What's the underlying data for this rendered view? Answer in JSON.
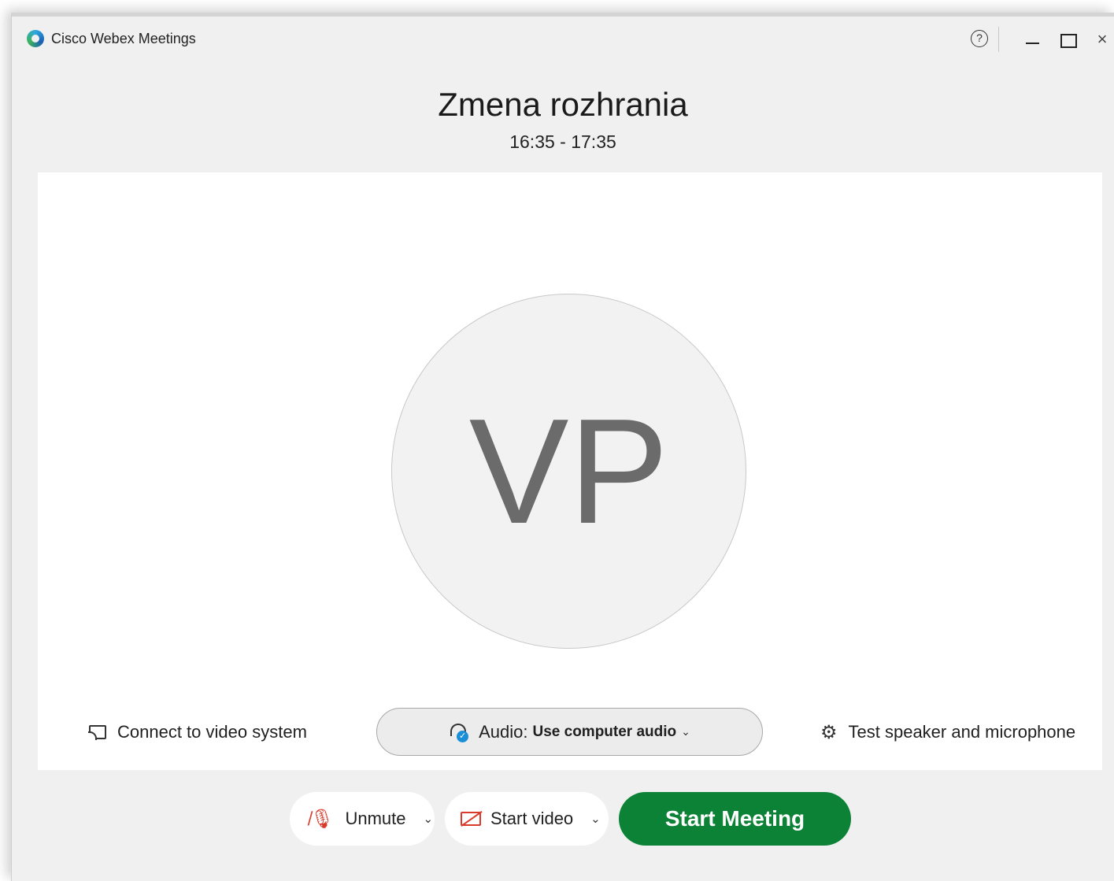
{
  "window": {
    "app_title": "Cisco Webex Meetings",
    "help_icon": "help-icon",
    "controls": {
      "minimize": "minimize-icon",
      "maximize": "maximize-icon",
      "close": "×"
    }
  },
  "meeting": {
    "title": "Zmena rozhrania",
    "time": "16:35 - 17:35"
  },
  "preview": {
    "avatar_initials": "VP",
    "connect_label": "Connect to video system",
    "audio_label": "Audio:",
    "audio_value": "Use computer audio",
    "audio_chevron": "⌄",
    "test_label": "Test speaker and microphone",
    "gear_glyph": "⚙"
  },
  "controls": {
    "unmute_label": "Unmute",
    "start_video_label": "Start video",
    "chevron": "⌄",
    "mic_glyph": "🎙",
    "start_meeting_label": "Start Meeting"
  },
  "colors": {
    "start_button": "#0b8236",
    "muted_icons": "#d93a2b",
    "audio_check": "#1a8fd8"
  }
}
